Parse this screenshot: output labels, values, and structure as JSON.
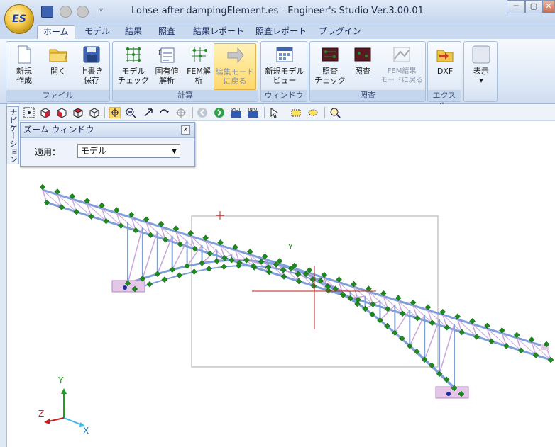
{
  "window": {
    "title": "Lohse-after-dampingElement.es - Engineer's Studio Ver.3.00.01",
    "logo_text": "ES",
    "qat_more": "▿",
    "min": "─",
    "max": "▢",
    "close": "✕"
  },
  "tabs": [
    "ホーム",
    "モデル",
    "結果",
    "照査",
    "結果レポート",
    "照査レポート",
    "プラグイン"
  ],
  "ribbon": {
    "groups": {
      "file": "ファイル",
      "calc": "計算",
      "window": "ウィンドウ",
      "check": "照査",
      "export": "エクスポ…"
    },
    "buttons": {
      "new": [
        "新規",
        "作成"
      ],
      "open": [
        "開く",
        ""
      ],
      "save": [
        "上書き",
        "保存"
      ],
      "model_check": [
        "モデル",
        "チェック"
      ],
      "eigen": [
        "固有値",
        "解析"
      ],
      "fem": [
        "FEM解",
        "析"
      ],
      "edit_mode": [
        "編集モード",
        "に戻る"
      ],
      "new_model_view": [
        "新規モデル",
        "ビュー"
      ],
      "check_check": [
        "照査",
        "チェック"
      ],
      "check": [
        "照査",
        ""
      ],
      "fem_result": [
        "FEM結果",
        "モードに戻る"
      ],
      "dxf": [
        "DXF",
        ""
      ],
      "display": [
        "表示",
        "▾"
      ]
    }
  },
  "nav": {
    "label": "ナビゲーション"
  },
  "zoom_window": {
    "title": "ズーム ウィンドウ",
    "close": "x",
    "apply_label": "適用：",
    "apply_value": "モデル"
  },
  "axes": {
    "x": "X",
    "y": "Y",
    "z": "Z"
  },
  "origin_axis_label": "Y",
  "colors": {
    "member": "#7f9fd9",
    "brace": "#c9a5dc",
    "node": "#1e8a1e",
    "support": "#e4c7e8"
  }
}
